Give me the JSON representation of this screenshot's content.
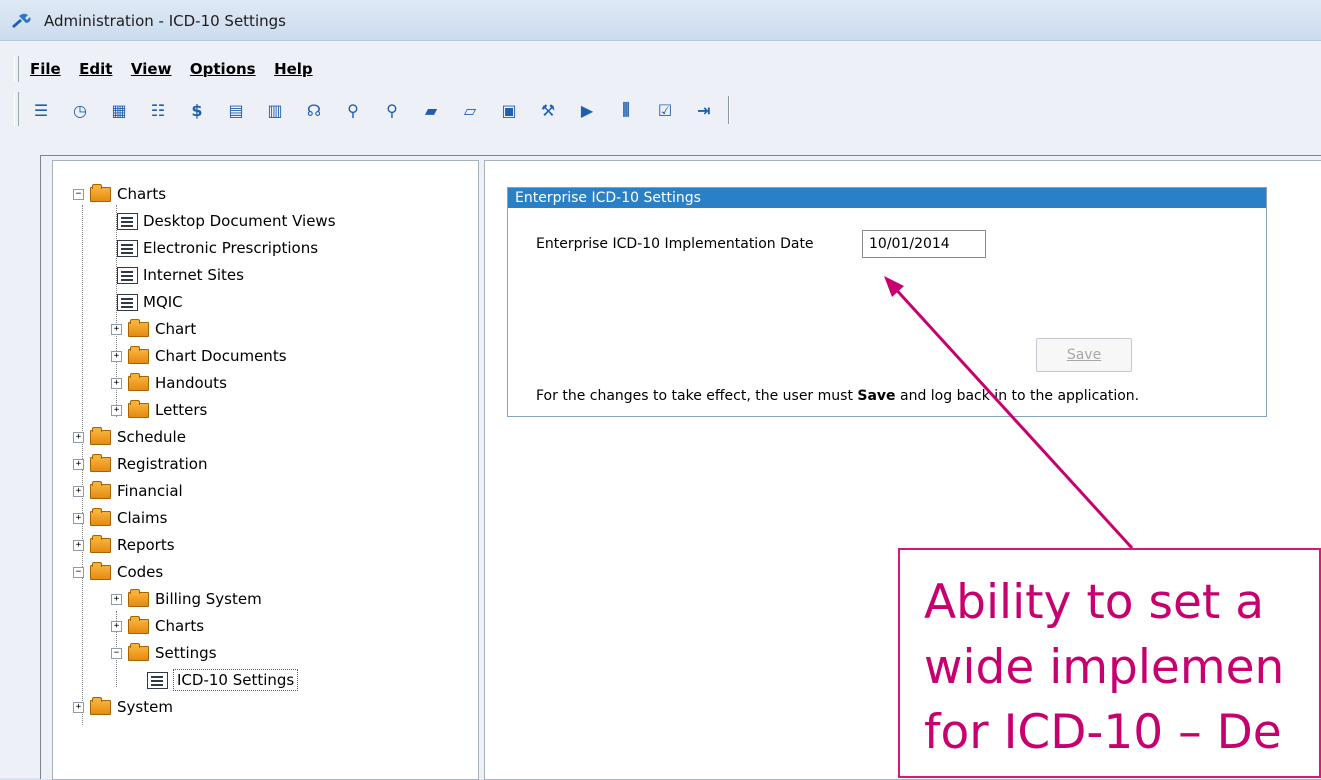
{
  "window": {
    "title": "Administration - ICD-10 Settings"
  },
  "menu": [
    "File",
    "Edit",
    "View",
    "Options",
    "Help"
  ],
  "toolbar_icons": [
    "document-list-icon",
    "stopwatch-icon",
    "grid-icon",
    "people-icon",
    "dollar-icon",
    "ledger-icon",
    "calculator-icon",
    "money-hand-icon",
    "search-doc-icon",
    "search-report-icon",
    "folder-arrow-icon",
    "folder-open-icon",
    "form-icon",
    "wrench-icon",
    "payment-icon",
    "chart-bars-icon",
    "checklist-icon",
    "exit-icon"
  ],
  "tree": [
    {
      "label": "Charts",
      "type": "folder",
      "level": 0,
      "expander": "minus"
    },
    {
      "label": "Desktop Document Views",
      "type": "doc",
      "level": 1
    },
    {
      "label": "Electronic Prescriptions",
      "type": "doc",
      "level": 1
    },
    {
      "label": "Internet Sites",
      "type": "doc",
      "level": 1
    },
    {
      "label": "MQIC",
      "type": "doc",
      "level": 1
    },
    {
      "label": "Chart",
      "type": "folder",
      "level": 1,
      "expander": "plus"
    },
    {
      "label": "Chart Documents",
      "type": "folder",
      "level": 1,
      "expander": "plus"
    },
    {
      "label": "Handouts",
      "type": "folder",
      "level": 1,
      "expander": "plus"
    },
    {
      "label": "Letters",
      "type": "folder",
      "level": 1,
      "expander": "plus"
    },
    {
      "label": "Schedule",
      "type": "folder",
      "level": 0,
      "expander": "plus"
    },
    {
      "label": "Registration",
      "type": "folder",
      "level": 0,
      "expander": "plus"
    },
    {
      "label": "Financial",
      "type": "folder",
      "level": 0,
      "expander": "plus"
    },
    {
      "label": "Claims",
      "type": "folder",
      "level": 0,
      "expander": "plus"
    },
    {
      "label": "Reports",
      "type": "folder",
      "level": 0,
      "expander": "plus"
    },
    {
      "label": "Codes",
      "type": "folder",
      "level": 0,
      "expander": "minus"
    },
    {
      "label": "Billing System",
      "type": "folder",
      "level": 1,
      "expander": "plus"
    },
    {
      "label": "Charts",
      "type": "folder",
      "level": 1,
      "expander": "plus"
    },
    {
      "label": "Settings",
      "type": "folder",
      "level": 1,
      "expander": "minus"
    },
    {
      "label": "ICD-10 Settings",
      "type": "doc",
      "level": 2,
      "selected": true
    },
    {
      "label": "System",
      "type": "folder",
      "level": 0,
      "expander": "plus"
    }
  ],
  "settings_panel": {
    "header": "Enterprise ICD-10 Settings",
    "date_label": "Enterprise ICD-10 Implementation Date",
    "date_value": "10/01/2014",
    "save_label": "Save",
    "note_prefix": "For the changes to take effect, the user must ",
    "note_bold": "Save",
    "note_suffix": " and log back in to the application."
  },
  "callout": {
    "text": "Ability to set a\nwide implemen\nfor ICD-10 – De",
    "color": "#c8006f"
  }
}
